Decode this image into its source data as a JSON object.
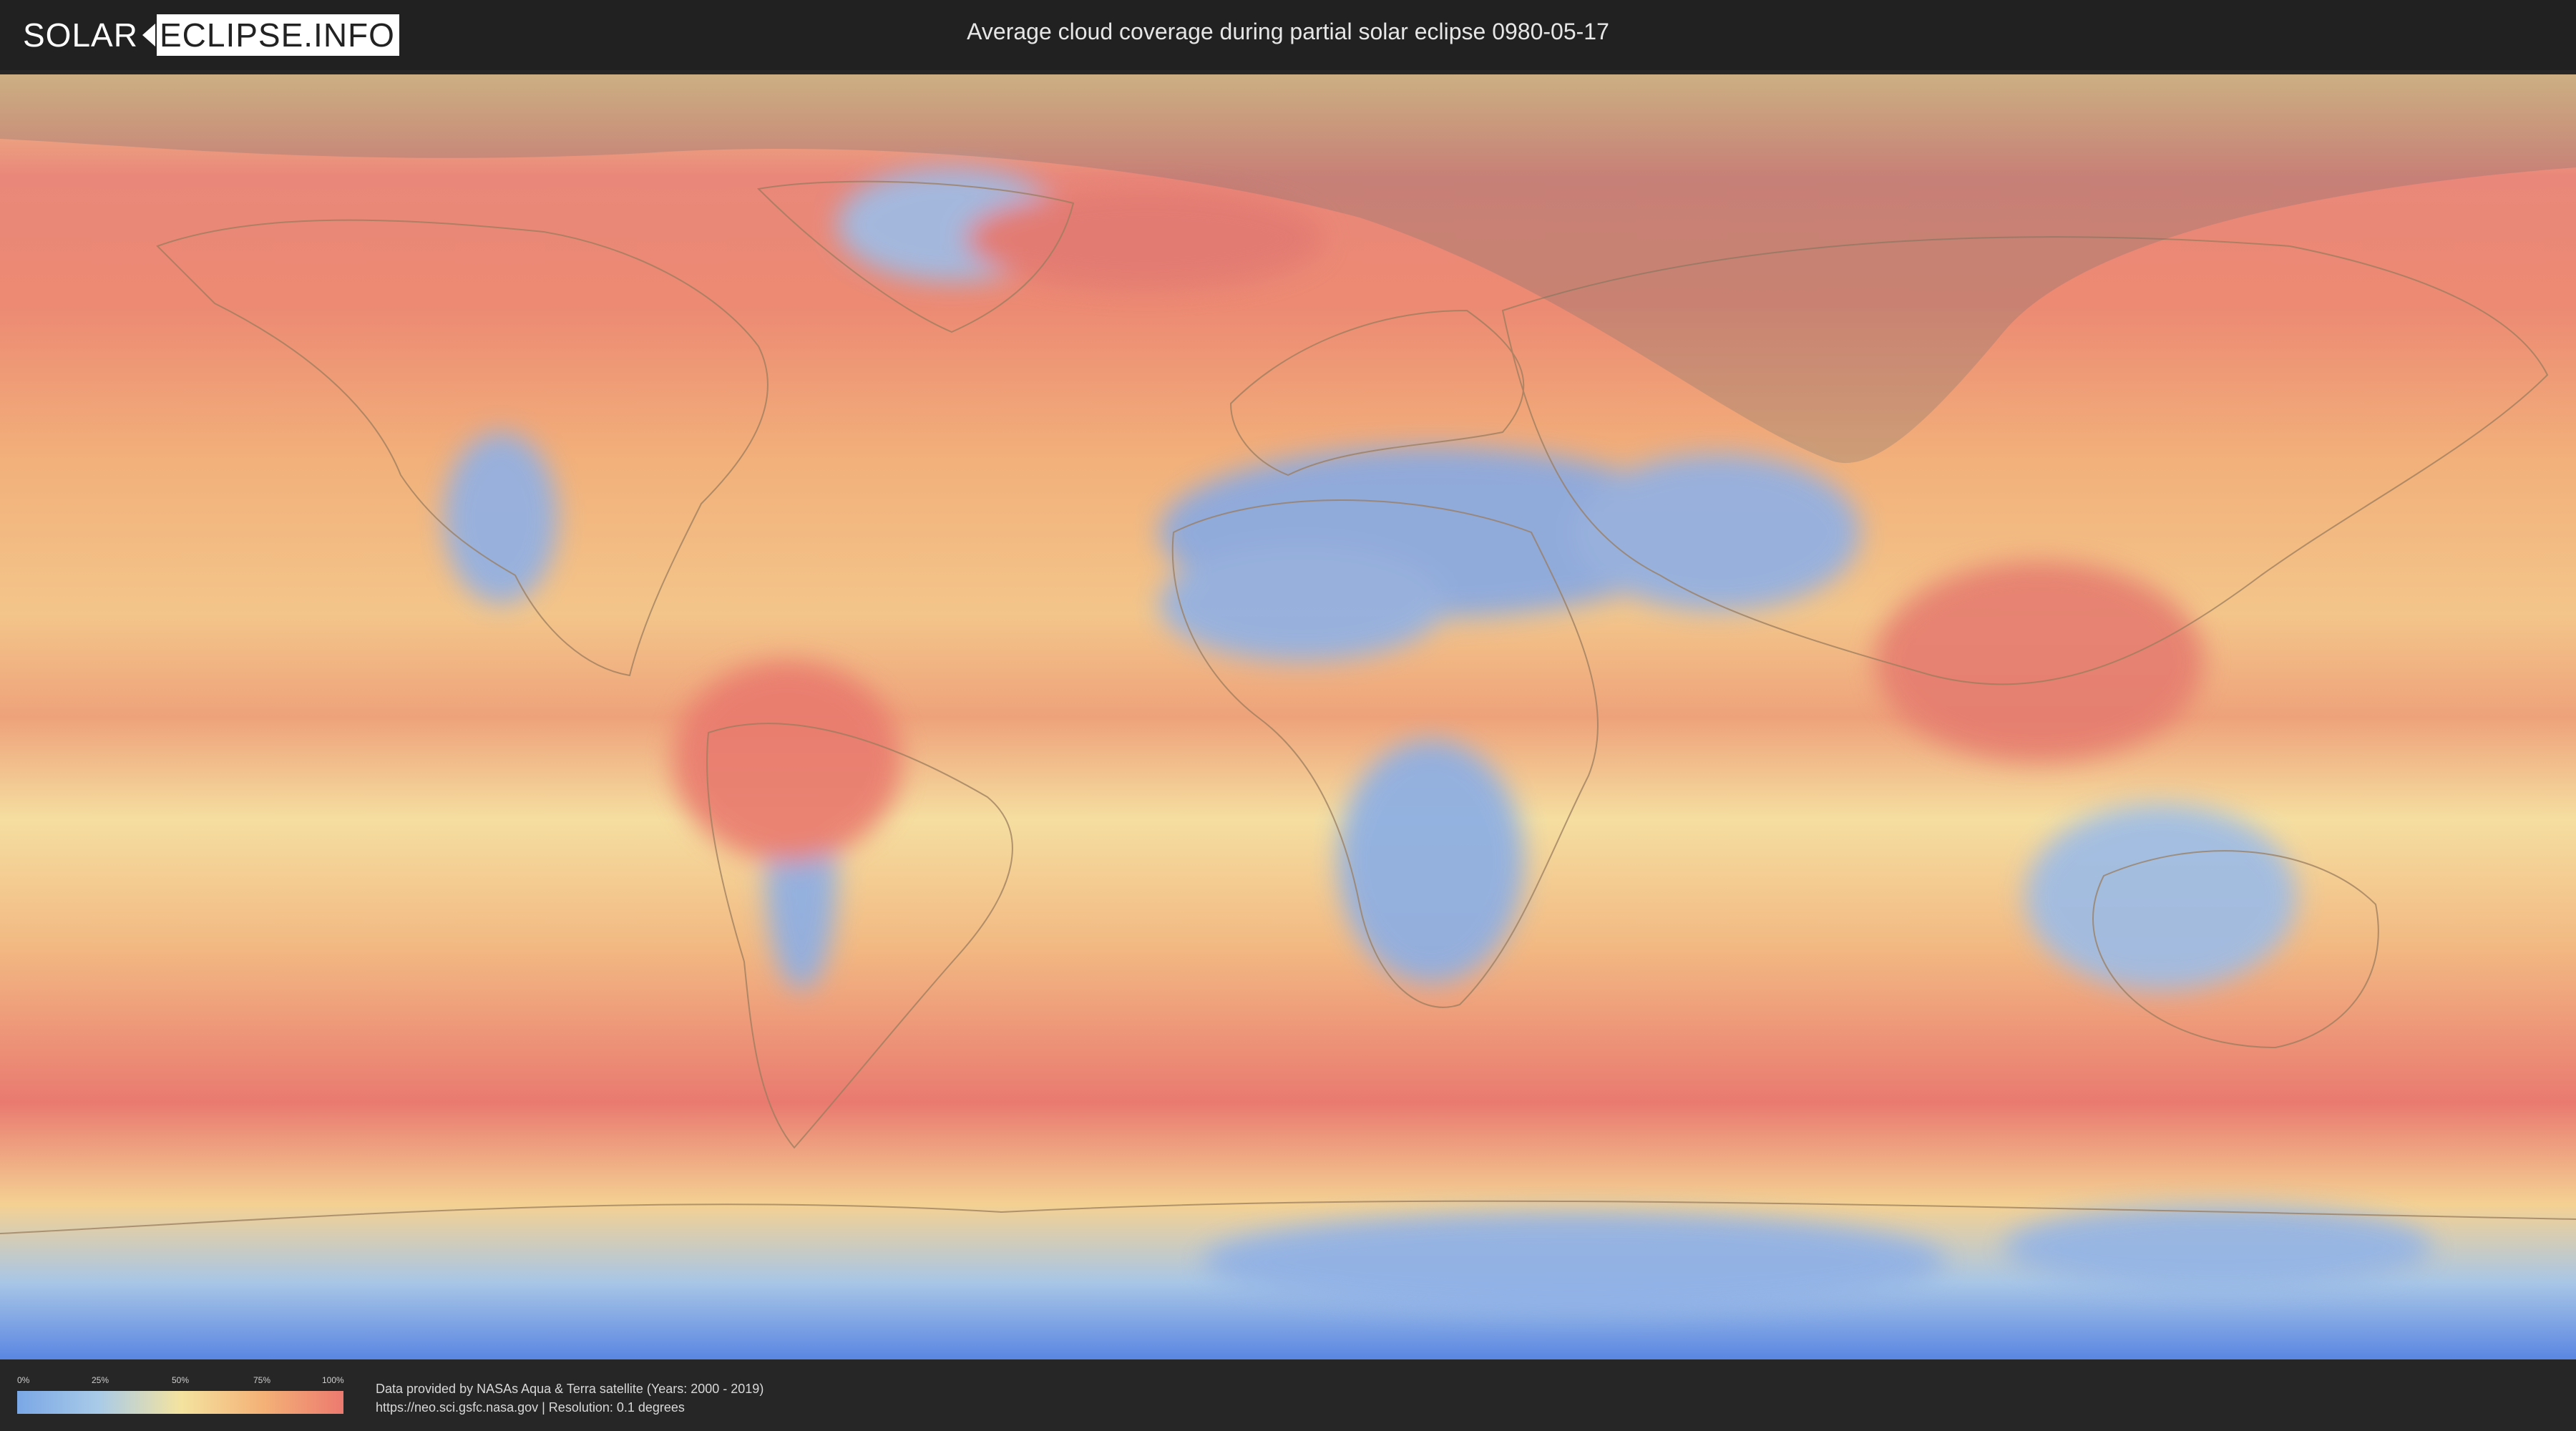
{
  "header": {
    "logo_left": "SOLAR",
    "logo_right": "ECLIPSE.INFO",
    "title": "Average cloud coverage during partial solar eclipse 0980-05-17"
  },
  "map": {
    "icon": "world-map-icon",
    "colors": {
      "clear": "#7aa7e6",
      "low": "#a9cbe8",
      "mid": "#f4e3a0",
      "high": "#f4b277",
      "overcast": "#ec7a6f",
      "eclipse_shade": "#6f6f6f"
    }
  },
  "legend": {
    "ticks": [
      "0%",
      "25%",
      "50%",
      "75%",
      "100%"
    ]
  },
  "credits": {
    "line1": "Data provided by NASAs Aqua & Terra satellite (Years: 2000 - 2019)",
    "line2": "https://neo.sci.gsfc.nasa.gov | Resolution: 0.1 degrees"
  }
}
